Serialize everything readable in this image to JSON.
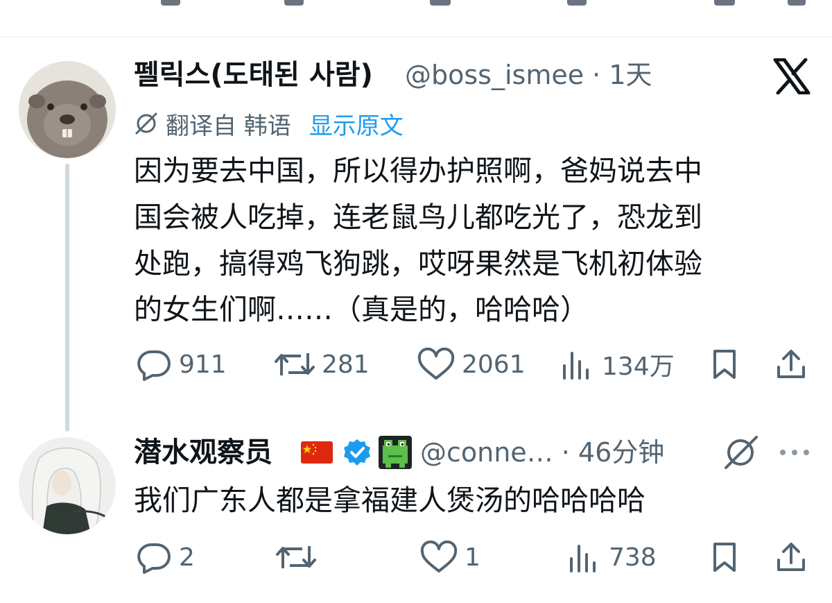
{
  "tweet": {
    "author_name": "펠릭스(도태된 사람)",
    "handle_time": "@boss_ismee · 1天",
    "translate": {
      "label": "翻译自 韩语",
      "show_original": "显示原文"
    },
    "text_lines": [
      "因为要去中国，所以得办护照啊，爸妈说去中",
      "国会被人吃掉，连老鼠鸟儿都吃光了，恐龙到",
      "处跑，搞得鸡飞狗跳，哎呀果然是飞机初体验",
      "的女生们啊……（真是的，哈哈哈）"
    ],
    "stats": {
      "replies": "911",
      "retweets": "281",
      "likes": "2061",
      "views": "134万"
    }
  },
  "reply": {
    "author_name": "潜水观察员",
    "handle_time": "@conne… · 46分钟",
    "text": "我们广东人都是拿福建人煲汤的哈哈哈哈",
    "stats": {
      "replies": "2",
      "retweets": "",
      "likes": "1",
      "views": "738"
    }
  },
  "icons": [
    "x-logo-icon",
    "translate-icon",
    "reply-icon",
    "retweet-icon",
    "like-icon",
    "views-icon",
    "bookmark-icon",
    "share-icon",
    "more-icon",
    "china-flag-icon",
    "verified-badge-icon",
    "frog-emoji-icon"
  ],
  "colors": {
    "text": "#0f1419",
    "secondary": "#536471",
    "link": "#1d9bf0",
    "verified": "#1d9bf0",
    "thread_line": "#cfd9de"
  }
}
